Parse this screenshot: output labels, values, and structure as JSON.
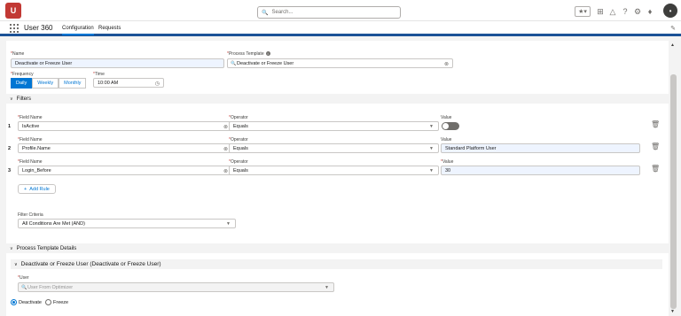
{
  "header": {
    "logo_text": "U",
    "search_placeholder": "Search...",
    "avatar_initial": "•"
  },
  "nav": {
    "app_name": "User 360",
    "tabs": [
      "Configuration",
      "Requests"
    ],
    "active_tab": "Configuration"
  },
  "form": {
    "name_label": "Name",
    "name_value": "Deactivate or Freeze User",
    "process_template_label": "Process Template",
    "process_template_value": "Deactivate or Freeze User",
    "frequency_label": "Frequency",
    "frequency_options": [
      "Daily",
      "Weekly",
      "Monthly"
    ],
    "frequency_selected": "Daily",
    "time_label": "Time",
    "time_value": "10:00 AM"
  },
  "filters": {
    "section_title": "Filters",
    "field_name_label": "Field Name",
    "operator_label": "Operator",
    "value_label": "Value",
    "rows": [
      {
        "num": "1",
        "field": "IsActive",
        "operator": "Equals",
        "value": "",
        "value_type": "toggle"
      },
      {
        "num": "2",
        "field": "Profile.Name",
        "operator": "Equals",
        "value": "Standard Platform User",
        "value_type": "text"
      },
      {
        "num": "3",
        "field": "Login_Before",
        "operator": "Equals",
        "value": "30",
        "value_type": "text"
      }
    ],
    "add_rule_label": "Add Rule",
    "criteria_label": "Filter Criteria",
    "criteria_value": "All Conditions Are Met (AND)"
  },
  "details": {
    "section_title": "Process Template Details",
    "sub_title": "Deactivate or Freeze User (Deactivate or Freeze User)",
    "user_label": "User",
    "user_placeholder": "User From Optimizer",
    "action_options": [
      "Deactivate",
      "Freeze"
    ],
    "action_selected": "Deactivate"
  },
  "colors": {
    "brand": "#0176d3",
    "nav_bar": "#1b5297",
    "logo": "#c23934"
  }
}
